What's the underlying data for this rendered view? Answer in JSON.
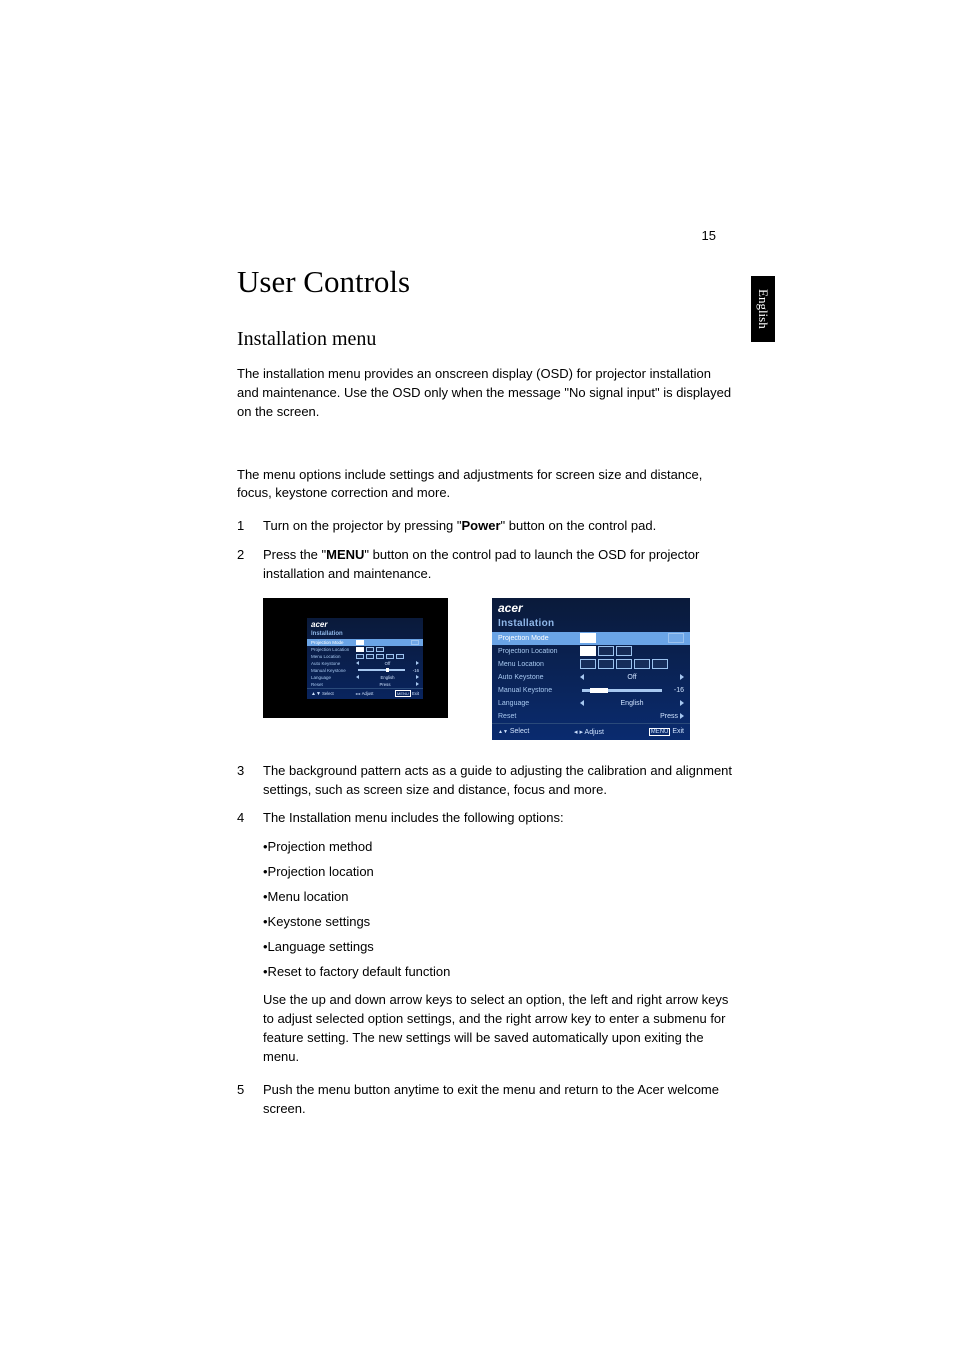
{
  "page_number": "15",
  "language_tab": "English",
  "h1": "User Controls",
  "h2": "Installation menu",
  "intro": "The installation menu provides an onscreen display (OSD) for projector installation and maintenance. Use the OSD only when the message \"No signal input\" is displayed on the screen.",
  "para2": "The menu options include settings and adjustments for screen size and distance, focus, keystone correction and more.",
  "steps": {
    "s1": {
      "n": "1",
      "pre": "Turn on the projector by pressing \"",
      "bold": "Power",
      "post": "\" button on the control pad."
    },
    "s2": {
      "n": "2",
      "pre": "Press the \"",
      "bold": "MENU",
      "post": "\" button on the control pad to launch the OSD for projector installation and maintenance."
    },
    "s3": {
      "n": "3",
      "text": "The background pattern acts as a guide to adjusting the calibration and alignment settings, such as screen size and distance, focus and more."
    },
    "s4": {
      "n": "4",
      "text": "The Installation menu includes the following options:"
    },
    "s5": {
      "n": "5",
      "text": "Push the menu button anytime to exit the menu and return to the Acer welcome screen."
    }
  },
  "bullets": {
    "b1": "•Projection method",
    "b2": "•Projection location",
    "b3": "•Menu location",
    "b4": "•Keystone settings",
    "b5": "•Language settings",
    "b6": "•Reset to factory default function"
  },
  "arrow_para": "Use the up and down arrow keys to select an option, the left and right arrow keys to adjust selected option settings, and the right arrow key to enter a submenu for feature setting. The new settings will be saved automatically upon exiting the menu.",
  "osd": {
    "brand": "acer",
    "title": "Installation",
    "rows": {
      "mode": "Projection Mode",
      "loc": "Projection Location",
      "menu": "Menu Location",
      "autok": "Auto Keystone",
      "mank": "Manual Keystone",
      "lang": "Language",
      "reset": "Reset"
    },
    "vals": {
      "off": "Off",
      "english": "English",
      "press": "Press",
      "mank_num": "-16"
    },
    "foot": {
      "select": "Select",
      "adjust": "Adjust",
      "menu": "MENU",
      "exit": "Exit"
    }
  }
}
